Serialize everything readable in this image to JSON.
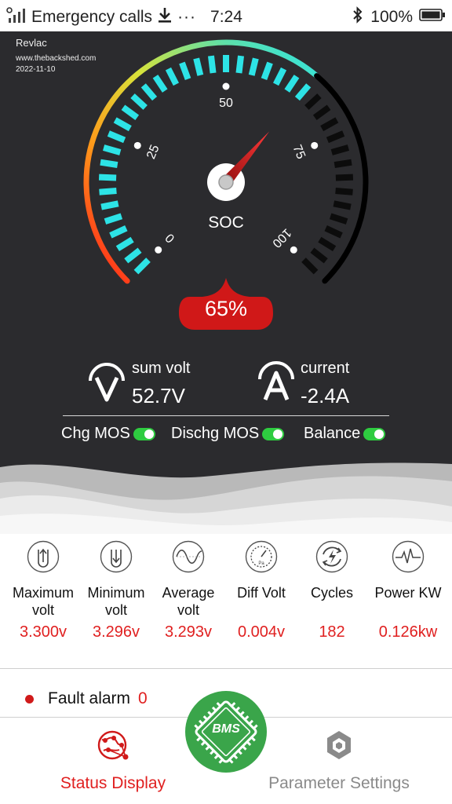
{
  "status_bar": {
    "carrier": "Emergency calls",
    "more": "···",
    "time": "7:24",
    "battery": "100%"
  },
  "watermark": {
    "author": "Revlac",
    "site": "www.thebackshed.com",
    "date": "2022-11-10"
  },
  "gauge": {
    "label": "SOC",
    "value_text": "65%",
    "value": 65,
    "ticks": [
      "0",
      "25",
      "50",
      "75",
      "100"
    ]
  },
  "metrics": {
    "sum_volt": {
      "label": "sum volt",
      "value": "52.7V"
    },
    "current": {
      "label": "current",
      "value": "-2.4A"
    }
  },
  "toggles": [
    {
      "label": "Chg MOS",
      "on": true
    },
    {
      "label": "Dischg MOS",
      "on": true
    },
    {
      "label": "Balance",
      "on": true
    }
  ],
  "stats": [
    {
      "name": "Maximum volt",
      "value": "3.300v",
      "icon": "max-volt-icon"
    },
    {
      "name": "Minimum volt",
      "value": "3.296v",
      "icon": "min-volt-icon"
    },
    {
      "name": "Average volt",
      "value": "3.293v",
      "icon": "sine-wave-icon"
    },
    {
      "name": "Diff Volt",
      "value": "0.004v",
      "icon": "pressure-gauge-icon"
    },
    {
      "name": "Cycles",
      "value": "182",
      "icon": "cycle-bolt-icon"
    },
    {
      "name": "Power KW",
      "value": "0.126kw",
      "icon": "power-pulse-icon"
    }
  ],
  "fault": {
    "label": "Fault alarm",
    "count": "0"
  },
  "nav": {
    "status": "Status Display",
    "bms": "BMS",
    "params": "Parameter Settings"
  },
  "colors": {
    "accent_red": "#e02020",
    "teal": "#2de3e6",
    "dark_bg": "#2b2b2e",
    "switch_green": "#2ecc40",
    "bms_green": "#3aa54a"
  }
}
